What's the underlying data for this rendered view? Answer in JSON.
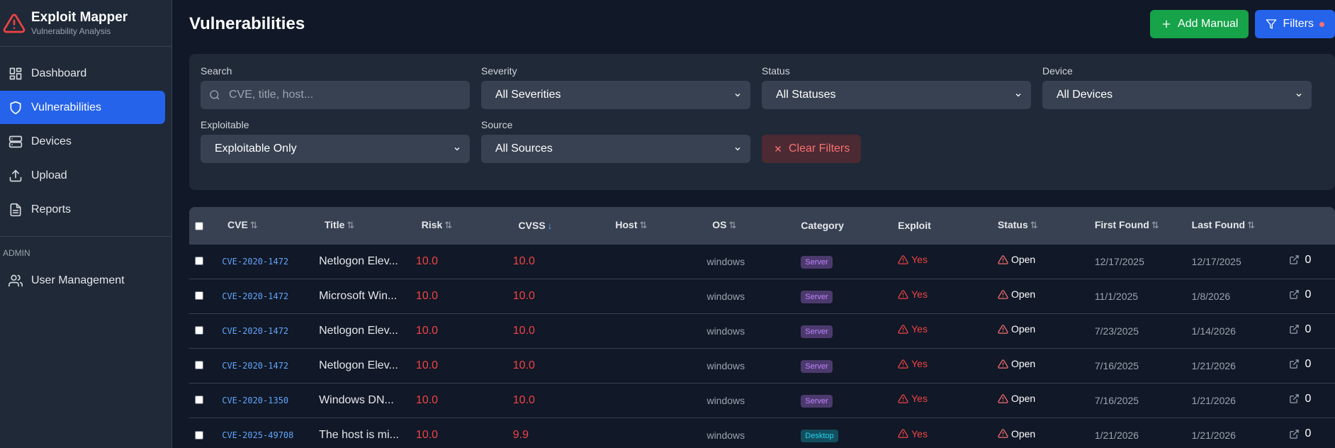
{
  "sidebar": {
    "app_title": "Exploit Mapper",
    "app_subtitle": "Vulnerability Analysis",
    "items": [
      {
        "label": "Dashboard",
        "icon": "dashboard-icon"
      },
      {
        "label": "Vulnerabilities",
        "icon": "shield-icon",
        "active": true
      },
      {
        "label": "Devices",
        "icon": "server-icon"
      },
      {
        "label": "Upload",
        "icon": "upload-icon"
      },
      {
        "label": "Reports",
        "icon": "document-icon"
      }
    ],
    "admin_section": "ADMIN",
    "admin_items": [
      {
        "label": "User Management",
        "icon": "users-icon"
      }
    ]
  },
  "header": {
    "title": "Vulnerabilities",
    "add_manual_label": "Add Manual",
    "filters_label": "Filters"
  },
  "filters": {
    "search_label": "Search",
    "search_placeholder": "CVE, title, host...",
    "severity_label": "Severity",
    "severity_value": "All Severities",
    "status_label": "Status",
    "status_value": "All Statuses",
    "device_label": "Device",
    "device_value": "All Devices",
    "exploitable_label": "Exploitable",
    "exploitable_value": "Exploitable Only",
    "source_label": "Source",
    "source_value": "All Sources",
    "clear_label": "Clear Filters"
  },
  "table": {
    "columns": [
      "CVE",
      "Title",
      "Risk",
      "CVSS",
      "Host",
      "OS",
      "Category",
      "Exploit",
      "Status",
      "First Found",
      "Last Found"
    ],
    "rows": [
      {
        "cve": "CVE-2020-1472",
        "title": "Netlogon Elev...",
        "risk": "10.0",
        "cvss": "10.0",
        "host": "",
        "os": "windows",
        "category": "Server",
        "exploit": "Yes",
        "status": "Open",
        "first_found": "12/17/2025",
        "last_found": "12/17/2025",
        "links": "0"
      },
      {
        "cve": "CVE-2020-1472",
        "title": "Microsoft Win...",
        "risk": "10.0",
        "cvss": "10.0",
        "host": "",
        "os": "windows",
        "category": "Server",
        "exploit": "Yes",
        "status": "Open",
        "first_found": "11/1/2025",
        "last_found": "1/8/2026",
        "links": "0"
      },
      {
        "cve": "CVE-2020-1472",
        "title": "Netlogon Elev...",
        "risk": "10.0",
        "cvss": "10.0",
        "host": "",
        "os": "windows",
        "category": "Server",
        "exploit": "Yes",
        "status": "Open",
        "first_found": "7/23/2025",
        "last_found": "1/14/2026",
        "links": "0"
      },
      {
        "cve": "CVE-2020-1472",
        "title": "Netlogon Elev...",
        "risk": "10.0",
        "cvss": "10.0",
        "host": "",
        "os": "windows",
        "category": "Server",
        "exploit": "Yes",
        "status": "Open",
        "first_found": "7/16/2025",
        "last_found": "1/21/2026",
        "links": "0"
      },
      {
        "cve": "CVE-2020-1350",
        "title": "Windows DN...",
        "risk": "10.0",
        "cvss": "10.0",
        "host": "",
        "os": "windows",
        "category": "Server",
        "exploit": "Yes",
        "status": "Open",
        "first_found": "7/16/2025",
        "last_found": "1/21/2026",
        "links": "0"
      },
      {
        "cve": "CVE-2025-49708",
        "title": "The host is mi...",
        "risk": "10.0",
        "cvss": "9.9",
        "host": "",
        "os": "windows",
        "category": "Desktop",
        "exploit": "Yes",
        "status": "Open",
        "first_found": "1/21/2026",
        "last_found": "1/21/2026",
        "links": "0"
      }
    ]
  }
}
